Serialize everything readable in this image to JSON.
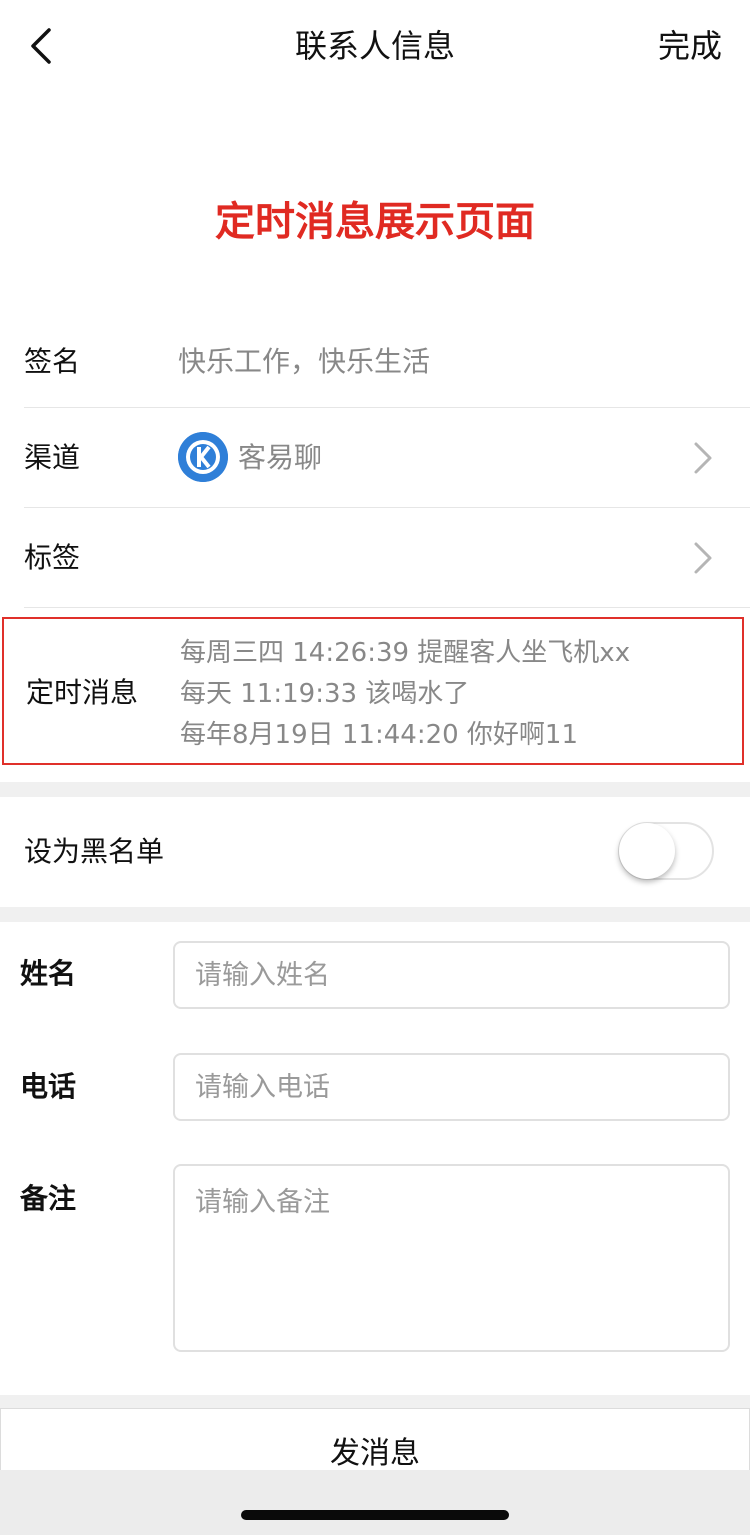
{
  "nav": {
    "title": "联系人信息",
    "done_label": "完成"
  },
  "banner": {
    "text": "定时消息展示页面",
    "color": "#e02a22"
  },
  "signature": {
    "label": "签名",
    "value": "快乐工作，快乐生活"
  },
  "channel": {
    "label": "渠道",
    "icon": "keyiliao-logo-icon",
    "name": "客易聊"
  },
  "tags": {
    "label": "标签"
  },
  "scheduled": {
    "label": "定时消息",
    "lines": [
      "每周三四 14:26:39 提醒客人坐飞机xx",
      "每天 11:19:33 该喝水了",
      "每年8月19日 11:44:20 你好啊11"
    ]
  },
  "blacklist": {
    "label": "设为黑名单",
    "on": false
  },
  "form": {
    "name": {
      "label": "姓名",
      "placeholder": "请输入姓名"
    },
    "phone": {
      "label": "电话",
      "placeholder": "请输入电话"
    },
    "note": {
      "label": "备注",
      "placeholder": "请输入备注"
    }
  },
  "send_label": "发消息"
}
